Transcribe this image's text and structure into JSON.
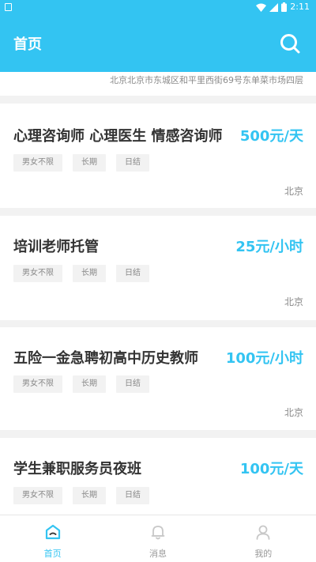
{
  "status_bar": {
    "time": "2:11"
  },
  "app_bar": {
    "title": "首页"
  },
  "address": "北京北京市东城区和平里西街69号东单菜市场四层",
  "jobs": [
    {
      "title": "心理咨询师 心理医生 情感咨询师",
      "salary": "500元/天",
      "tags": [
        "男女不限",
        "长期",
        "日结"
      ],
      "location": "北京"
    },
    {
      "title": "培训老师托管",
      "salary": "25元/小时",
      "tags": [
        "男女不限",
        "长期",
        "日结"
      ],
      "location": "北京"
    },
    {
      "title": "五险一金急聘初高中历史教师",
      "salary": "100元/小时",
      "tags": [
        "男女不限",
        "长期",
        "日结"
      ],
      "location": "北京"
    },
    {
      "title": "学生兼职服务员夜班",
      "salary": "100元/天",
      "tags": [
        "男女不限",
        "长期",
        "日结"
      ],
      "location": ""
    }
  ],
  "bottom_nav": [
    {
      "label": "首页",
      "icon": "home-icon",
      "active": true
    },
    {
      "label": "消息",
      "icon": "bell-icon",
      "active": false
    },
    {
      "label": "我的",
      "icon": "user-icon",
      "active": false
    }
  ],
  "colors": {
    "accent": "#33c4f2",
    "background": "#f2f2f2",
    "text": "#333333",
    "muted": "#888888"
  }
}
